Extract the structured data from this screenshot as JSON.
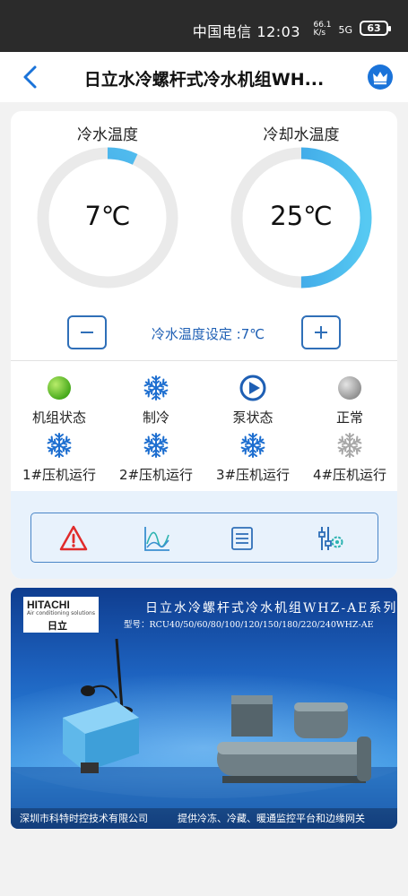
{
  "status_bar": {
    "text": "中国电信 12:03",
    "net_speed": "66.1 K/s",
    "signal": "5G",
    "battery": "63"
  },
  "header": {
    "title": "日立水冷螺杆式冷水机组WH..."
  },
  "gauges": [
    {
      "label": "冷水温度",
      "value": "7℃",
      "level": 0.07,
      "color": "#2f8fe0"
    },
    {
      "label": "冷却水温度",
      "value": "25℃",
      "level": 0.5,
      "color": "#3fb3ec"
    }
  ],
  "setpoint": {
    "text": "冷水温度设定 :7℃"
  },
  "status_items": [
    {
      "label": "机组状态",
      "icon": "green-status-dot-icon"
    },
    {
      "label": "制冷",
      "icon": "snowflake-icon"
    },
    {
      "label": "泵状态",
      "icon": "play-circle-icon"
    },
    {
      "label": "正常",
      "icon": "gray-status-dot-icon"
    },
    {
      "label": "1#压机运行",
      "icon": "snowflake-icon"
    },
    {
      "label": "2#压机运行",
      "icon": "snowflake-icon"
    },
    {
      "label": "3#压机运行",
      "icon": "snowflake-icon"
    },
    {
      "label": "4#压机运行",
      "icon": "snowflake-gray-icon"
    }
  ],
  "tools": [
    {
      "icon": "warning-icon"
    },
    {
      "icon": "chart-icon"
    },
    {
      "icon": "list-icon"
    },
    {
      "icon": "settings-sliders-icon"
    }
  ],
  "banner": {
    "brand": "HITACHI",
    "brand_tagline": "Air conditioning solutions",
    "brand_cn": "日立",
    "title": "日立水冷螺杆式冷水机组WHZ-AE系列",
    "model": "型号：RCU40/50/60/80/100/120/150/180/220/240WHZ-AE",
    "company": "深圳市科特时控技术有限公司",
    "slogan": "提供冷冻、冷藏、暖通监控平台和边缘网关"
  },
  "colors": {
    "accent": "#1e5fb4",
    "red": "#e02b2b",
    "green": "#5bbd2b"
  }
}
